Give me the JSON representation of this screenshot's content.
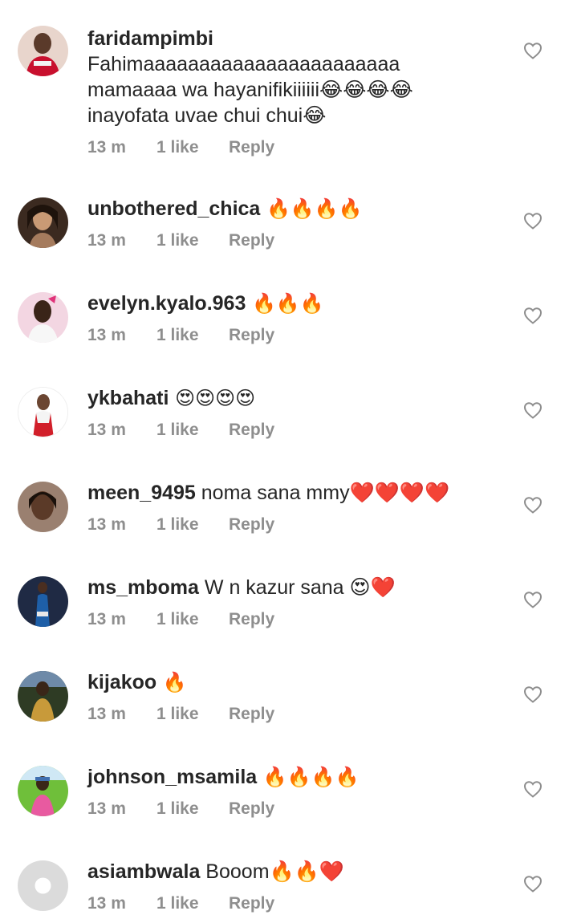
{
  "comments": [
    {
      "username": "faridampimbi",
      "lines": [
        "Fahimaaaaaaaaaaaaaaaaaaaaaaa",
        "mamaaaa wa hayanifikiiiiii😂😂😂😂",
        "inayofata uvae chui chui😂"
      ],
      "time": "13 m",
      "likes": "1 like",
      "reply": "Reply",
      "avatar": "avatar-red-outfit"
    },
    {
      "username": "unbothered_chica",
      "text": " 🔥🔥🔥🔥",
      "time": "13 m",
      "likes": "1 like",
      "reply": "Reply",
      "avatar": "avatar-woman-portrait"
    },
    {
      "username": "evelyn.kyalo.963",
      "text": " 🔥🔥🔥",
      "time": "13 m",
      "likes": "1 like",
      "reply": "Reply",
      "avatar": "avatar-pink-bow"
    },
    {
      "username": "ykbahati",
      "text": " 😍😍😍😍",
      "time": "13 m",
      "likes": "1 like",
      "reply": "Reply",
      "avatar": "avatar-white-red-dress"
    },
    {
      "username": "meen_9495",
      "text": " noma sana mmy❤️❤️❤️❤️",
      "time": "13 m",
      "likes": "1 like",
      "reply": "Reply",
      "avatar": "avatar-woman-face"
    },
    {
      "username": "ms_mboma",
      "text": " W n kazur sana 😍❤️",
      "time": "13 m",
      "likes": "1 like",
      "reply": "Reply",
      "avatar": "avatar-dark-blue-dress"
    },
    {
      "username": "kijakoo",
      "text": " 🔥",
      "time": "13 m",
      "likes": "1 like",
      "reply": "Reply",
      "avatar": "avatar-man-outdoor"
    },
    {
      "username": "johnson_msamila",
      "text": " 🔥🔥🔥🔥",
      "time": "13 m",
      "likes": "1 like",
      "reply": "Reply",
      "avatar": "avatar-green-outdoor"
    },
    {
      "username": "asiambwala",
      "text": " Booom🔥🔥❤️",
      "time": "13 m",
      "likes": "1 like",
      "reply": "Reply",
      "avatar": "avatar-default-placeholder"
    }
  ],
  "colors": {
    "username": "#262626",
    "meta": "#8e8e8e",
    "heart_outline": "#8e8e8e",
    "placeholder_avatar": "#dbdbdb"
  },
  "icons": {
    "like": "heart-outline-icon"
  }
}
